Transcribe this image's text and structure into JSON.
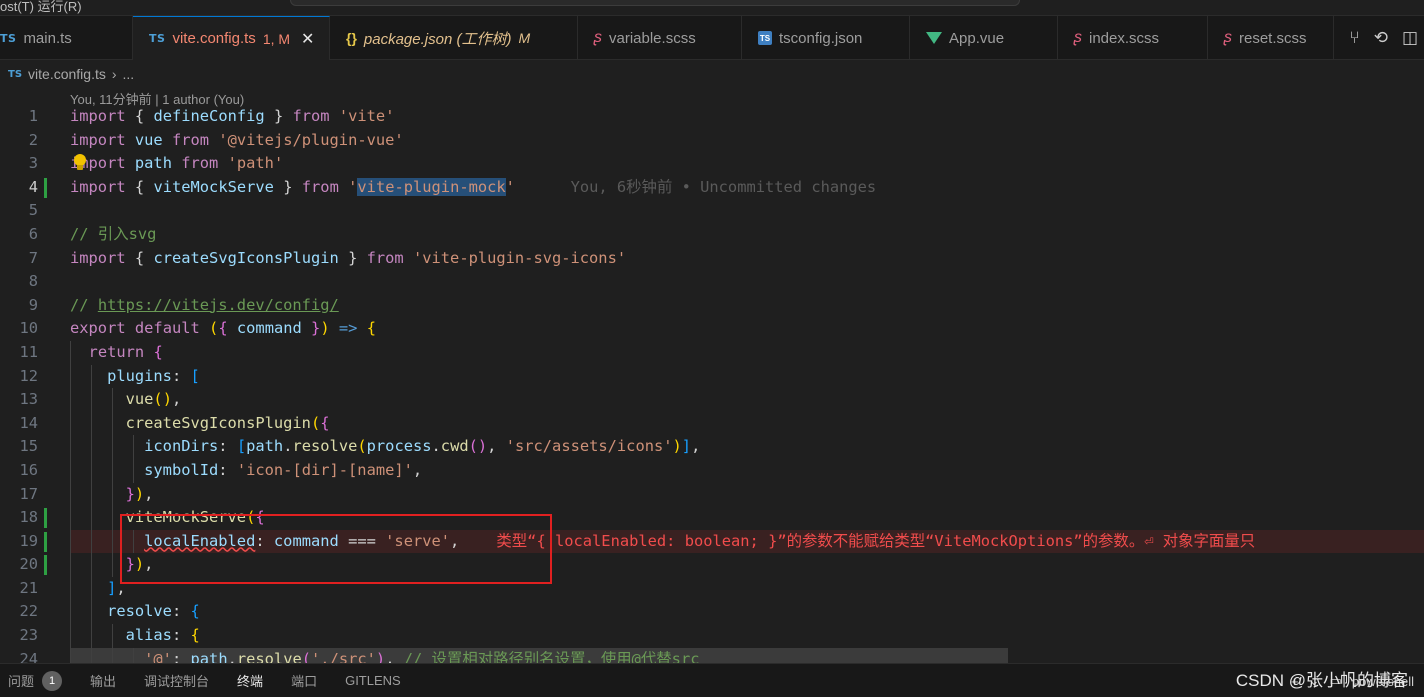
{
  "titlebar": {
    "menu_fragment": "ost(T)  运行(R)"
  },
  "tabs": [
    {
      "label": "main.ts",
      "icon": "TS"
    },
    {
      "label": "vite.config.ts",
      "icon": "TS",
      "status": "1, M"
    },
    {
      "label": "package.json (工作树)",
      "icon": "{}",
      "status": "M"
    },
    {
      "label": "variable.scss",
      "icon": "scss"
    },
    {
      "label": "tsconfig.json",
      "icon": "tsconfig"
    },
    {
      "label": "App.vue",
      "icon": "vue"
    },
    {
      "label": "index.scss",
      "icon": "scss"
    },
    {
      "label": "reset.scss",
      "icon": "scss"
    }
  ],
  "breadcrumb": {
    "icon": "TS",
    "file": "vite.config.ts",
    "more": "..."
  },
  "codelens": "You, 11分钟前 | 1 author (You)",
  "code": {
    "blame": "You, 6秒钟前 • Uncommitted changes",
    "error_message": "类型“{ localEnabled: boolean; }”的参数不能赋给类型“ViteMockOptions”的参数。⏎ 对象字面量只",
    "line_numbers": [
      "1",
      "2",
      "3",
      "4",
      "5",
      "6",
      "7",
      "8",
      "9",
      "10",
      "11",
      "12",
      "13",
      "14",
      "15",
      "16",
      "17",
      "18",
      "19",
      "20",
      "21",
      "22",
      "23",
      "24"
    ]
  },
  "panel": {
    "tabs": [
      "问题",
      "输出",
      "调试控制台",
      "终端",
      "端口",
      "GITLENS"
    ],
    "problems_count": "1",
    "terminal": "powershell"
  },
  "watermark": "CSDN @张小帆的博客"
}
